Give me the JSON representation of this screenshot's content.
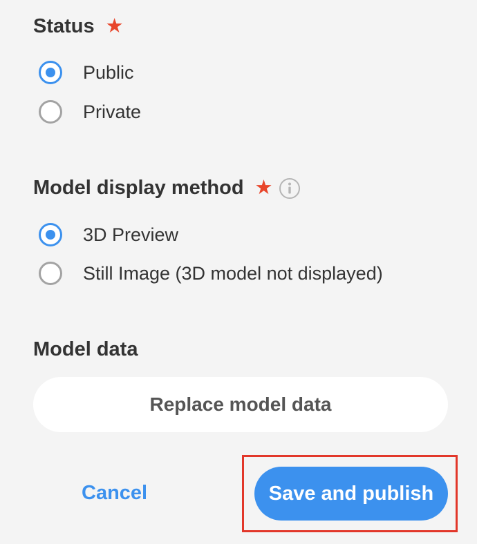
{
  "status": {
    "label": "Status",
    "required_mark": "★",
    "options": [
      {
        "label": "Public",
        "checked": true
      },
      {
        "label": "Private",
        "checked": false
      }
    ]
  },
  "display_method": {
    "label": "Model display method",
    "required_mark": "★",
    "info_icon": "info-circle-icon",
    "options": [
      {
        "label": "3D Preview",
        "checked": true
      },
      {
        "label": "Still Image (3D model not displayed)",
        "checked": false
      }
    ]
  },
  "model_data": {
    "label": "Model data",
    "replace_button": "Replace model data"
  },
  "actions": {
    "cancel": "Cancel",
    "save_publish": "Save and publish"
  },
  "colors": {
    "accent": "#3c91ee",
    "required": "#e8462b",
    "highlight": "#e2372a",
    "background": "#f4f4f4"
  }
}
